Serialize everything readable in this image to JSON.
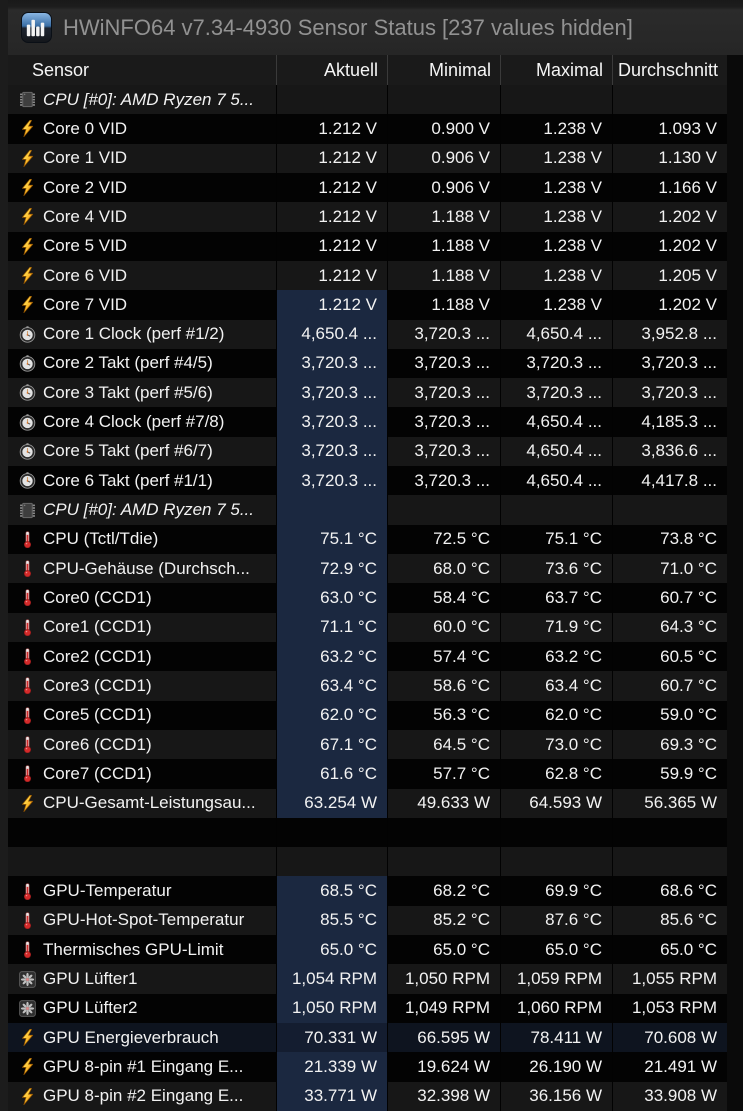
{
  "title_bar": {
    "title": "HWiNFO64 v7.34-4930 Sensor Status [237 values hidden]",
    "app_icon": "hwinfo-app-icon"
  },
  "columns": {
    "sensor": "Sensor",
    "current": "Aktuell",
    "minimum": "Minimal",
    "maximum": "Maximal",
    "average": "Durchschnitt"
  },
  "colors": {
    "current_column_highlight": "#1b2840",
    "selected_row_background": "#0e141f",
    "row_dark": "#030303",
    "row_light": "#171717",
    "header_background": "#1a1a1a",
    "titlebar_background": "#262626",
    "title_text": "#929292",
    "thermometer_icon_red": "#d42a2a",
    "lightning_icon_orange": "#f0930a"
  },
  "rows": [
    {
      "type": "group",
      "icon": "chip-icon",
      "label": "CPU [#0]: AMD Ryzen 7 5...",
      "values": [
        "",
        "",
        "",
        ""
      ],
      "current_highlighted": false
    },
    {
      "type": "sensor",
      "icon": "lightning-icon",
      "label": "Core 0 VID",
      "values": [
        "1.212 V",
        "0.900 V",
        "1.238 V",
        "1.093 V"
      ],
      "current_highlighted": false
    },
    {
      "type": "sensor",
      "icon": "lightning-icon",
      "label": "Core 1 VID",
      "values": [
        "1.212 V",
        "0.906 V",
        "1.238 V",
        "1.130 V"
      ],
      "current_highlighted": false
    },
    {
      "type": "sensor",
      "icon": "lightning-icon",
      "label": "Core 2 VID",
      "values": [
        "1.212 V",
        "0.906 V",
        "1.238 V",
        "1.166 V"
      ],
      "current_highlighted": false
    },
    {
      "type": "sensor",
      "icon": "lightning-icon",
      "label": "Core 4 VID",
      "values": [
        "1.212 V",
        "1.188 V",
        "1.238 V",
        "1.202 V"
      ],
      "current_highlighted": false
    },
    {
      "type": "sensor",
      "icon": "lightning-icon",
      "label": "Core 5 VID",
      "values": [
        "1.212 V",
        "1.188 V",
        "1.238 V",
        "1.202 V"
      ],
      "current_highlighted": false
    },
    {
      "type": "sensor",
      "icon": "lightning-icon",
      "label": "Core 6 VID",
      "values": [
        "1.212 V",
        "1.188 V",
        "1.238 V",
        "1.205 V"
      ],
      "current_highlighted": false
    },
    {
      "type": "sensor",
      "icon": "lightning-icon",
      "label": "Core 7 VID",
      "values": [
        "1.212 V",
        "1.188 V",
        "1.238 V",
        "1.202 V"
      ],
      "current_highlighted": true
    },
    {
      "type": "sensor",
      "icon": "clock-icon",
      "label": "Core 1 Clock (perf #1/2)",
      "values": [
        "4,650.4 ...",
        "3,720.3 ...",
        "4,650.4 ...",
        "3,952.8 ..."
      ],
      "current_highlighted": true
    },
    {
      "type": "sensor",
      "icon": "clock-icon",
      "label": "Core 2 Takt (perf #4/5)",
      "values": [
        "3,720.3 ...",
        "3,720.3 ...",
        "3,720.3 ...",
        "3,720.3 ..."
      ],
      "current_highlighted": true
    },
    {
      "type": "sensor",
      "icon": "clock-icon",
      "label": "Core 3 Takt (perf #5/6)",
      "values": [
        "3,720.3 ...",
        "3,720.3 ...",
        "3,720.3 ...",
        "3,720.3 ..."
      ],
      "current_highlighted": true
    },
    {
      "type": "sensor",
      "icon": "clock-icon",
      "label": "Core 4 Clock (perf #7/8)",
      "values": [
        "3,720.3 ...",
        "3,720.3 ...",
        "4,650.4 ...",
        "4,185.3 ..."
      ],
      "current_highlighted": true
    },
    {
      "type": "sensor",
      "icon": "clock-icon",
      "label": "Core 5 Takt (perf #6/7)",
      "values": [
        "3,720.3 ...",
        "3,720.3 ...",
        "4,650.4 ...",
        "3,836.6 ..."
      ],
      "current_highlighted": true
    },
    {
      "type": "sensor",
      "icon": "clock-icon",
      "label": "Core 6 Takt (perf #1/1)",
      "values": [
        "3,720.3 ...",
        "3,720.3 ...",
        "4,650.4 ...",
        "4,417.8 ..."
      ],
      "current_highlighted": true
    },
    {
      "type": "group",
      "icon": "chip-icon",
      "label": "CPU [#0]: AMD Ryzen 7 5...",
      "values": [
        "",
        "",
        "",
        ""
      ],
      "current_highlighted": true
    },
    {
      "type": "sensor",
      "icon": "thermometer-icon",
      "label": "CPU (Tctl/Tdie)",
      "values": [
        "75.1 °C",
        "72.5 °C",
        "75.1 °C",
        "73.8 °C"
      ],
      "current_highlighted": true
    },
    {
      "type": "sensor",
      "icon": "thermometer-icon",
      "label": "CPU-Gehäuse (Durchsch...",
      "values": [
        "72.9 °C",
        "68.0 °C",
        "73.6 °C",
        "71.0 °C"
      ],
      "current_highlighted": true
    },
    {
      "type": "sensor",
      "icon": "thermometer-icon",
      "label": "Core0 (CCD1)",
      "values": [
        "63.0 °C",
        "58.4 °C",
        "63.7 °C",
        "60.7 °C"
      ],
      "current_highlighted": true
    },
    {
      "type": "sensor",
      "icon": "thermometer-icon",
      "label": "Core1 (CCD1)",
      "values": [
        "71.1 °C",
        "60.0 °C",
        "71.9 °C",
        "64.3 °C"
      ],
      "current_highlighted": true
    },
    {
      "type": "sensor",
      "icon": "thermometer-icon",
      "label": "Core2 (CCD1)",
      "values": [
        "63.2 °C",
        "57.4 °C",
        "63.2 °C",
        "60.5 °C"
      ],
      "current_highlighted": true
    },
    {
      "type": "sensor",
      "icon": "thermometer-icon",
      "label": "Core3 (CCD1)",
      "values": [
        "63.4 °C",
        "58.6 °C",
        "63.4 °C",
        "60.7 °C"
      ],
      "current_highlighted": true
    },
    {
      "type": "sensor",
      "icon": "thermometer-icon",
      "label": "Core5 (CCD1)",
      "values": [
        "62.0 °C",
        "56.3 °C",
        "62.0 °C",
        "59.0 °C"
      ],
      "current_highlighted": true
    },
    {
      "type": "sensor",
      "icon": "thermometer-icon",
      "label": "Core6 (CCD1)",
      "values": [
        "67.1 °C",
        "64.5 °C",
        "73.0 °C",
        "69.3 °C"
      ],
      "current_highlighted": true
    },
    {
      "type": "sensor",
      "icon": "thermometer-icon",
      "label": "Core7 (CCD1)",
      "values": [
        "61.6 °C",
        "57.7 °C",
        "62.8 °C",
        "59.9 °C"
      ],
      "current_highlighted": true
    },
    {
      "type": "sensor",
      "icon": "lightning-icon",
      "label": "CPU-Gesamt-Leistungsau...",
      "values": [
        "63.254 W",
        "49.633 W",
        "64.593 W",
        "56.365 W"
      ],
      "current_highlighted": true
    },
    {
      "type": "empty",
      "icon": "",
      "label": "",
      "values": [
        "",
        "",
        "",
        ""
      ],
      "current_highlighted": false
    },
    {
      "type": "empty",
      "icon": "",
      "label": "",
      "values": [
        "",
        "",
        "",
        ""
      ],
      "current_highlighted": false
    },
    {
      "type": "sensor",
      "icon": "thermometer-icon",
      "label": "GPU-Temperatur",
      "values": [
        "68.5 °C",
        "68.2 °C",
        "69.9 °C",
        "68.6 °C"
      ],
      "current_highlighted": true
    },
    {
      "type": "sensor",
      "icon": "thermometer-icon",
      "label": "GPU-Hot-Spot-Temperatur",
      "values": [
        "85.5 °C",
        "85.2 °C",
        "87.6 °C",
        "85.6 °C"
      ],
      "current_highlighted": true
    },
    {
      "type": "sensor",
      "icon": "thermometer-icon",
      "label": "Thermisches GPU-Limit",
      "values": [
        "65.0 °C",
        "65.0 °C",
        "65.0 °C",
        "65.0 °C"
      ],
      "current_highlighted": true
    },
    {
      "type": "sensor",
      "icon": "fan-icon",
      "label": "GPU Lüfter1",
      "values": [
        "1,054 RPM",
        "1,050 RPM",
        "1,059 RPM",
        "1,055 RPM"
      ],
      "current_highlighted": true
    },
    {
      "type": "sensor",
      "icon": "fan-icon",
      "label": "GPU Lüfter2",
      "values": [
        "1,050 RPM",
        "1,049 RPM",
        "1,060 RPM",
        "1,053 RPM"
      ],
      "current_highlighted": true
    },
    {
      "type": "sensor",
      "icon": "lightning-icon",
      "label": "GPU Energieverbrauch",
      "values": [
        "70.331 W",
        "66.595 W",
        "78.411 W",
        "70.608 W"
      ],
      "current_highlighted": true,
      "selected": true
    },
    {
      "type": "sensor",
      "icon": "lightning-icon",
      "label": "GPU 8-pin #1 Eingang E...",
      "values": [
        "21.339 W",
        "19.624 W",
        "26.190 W",
        "21.491 W"
      ],
      "current_highlighted": true
    },
    {
      "type": "sensor",
      "icon": "lightning-icon",
      "label": "GPU 8-pin #2 Eingang E...",
      "values": [
        "33.771 W",
        "32.398 W",
        "36.156 W",
        "33.908 W"
      ],
      "current_highlighted": true
    }
  ]
}
